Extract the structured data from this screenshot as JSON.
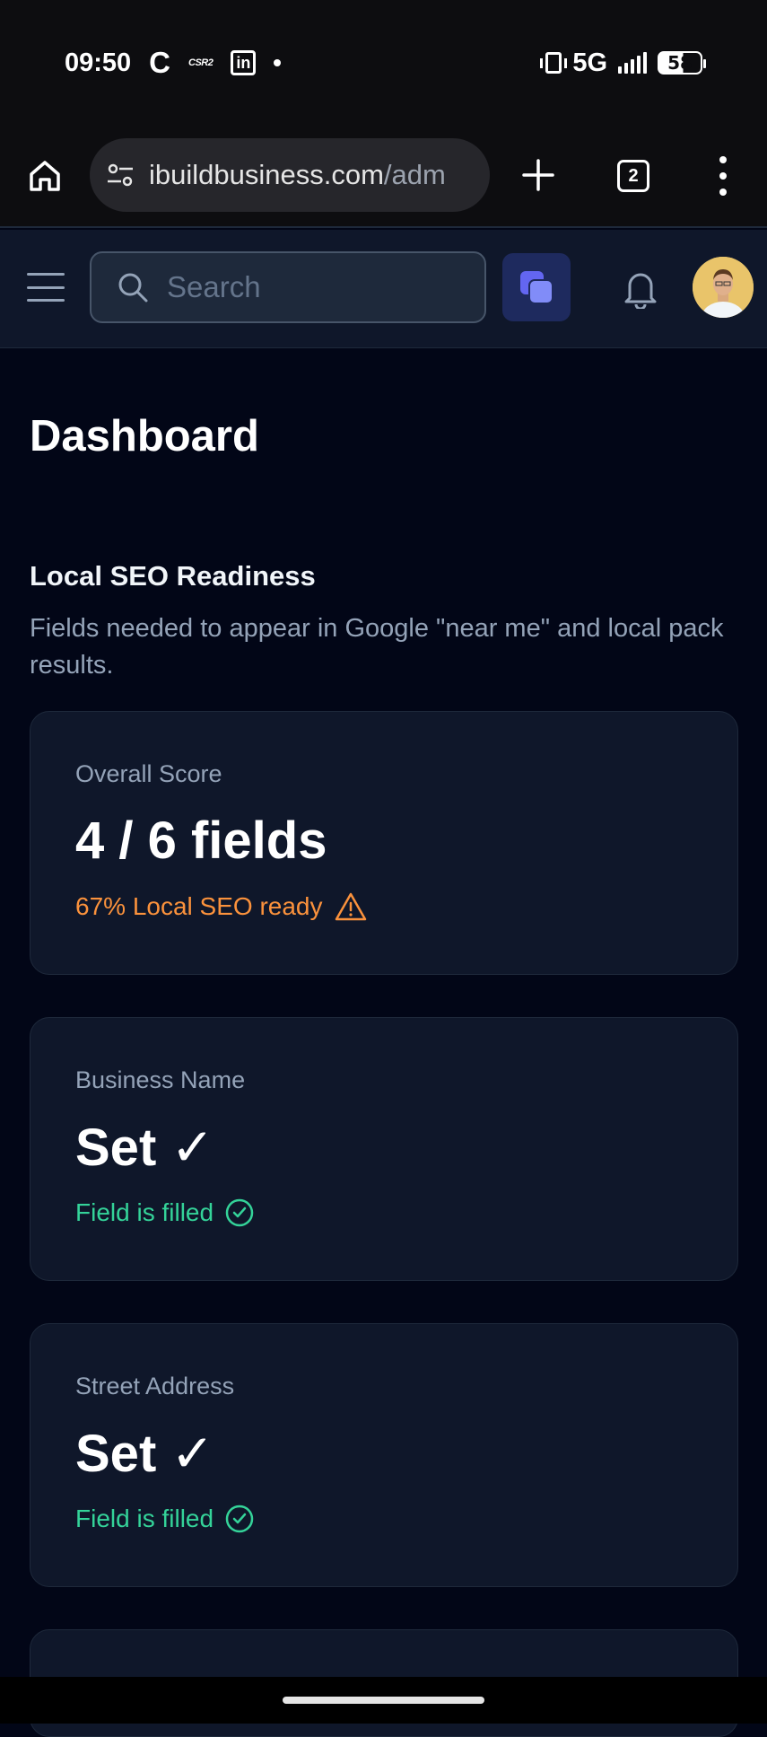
{
  "status_bar": {
    "time": "09:50",
    "app_icons": [
      "C",
      "CSR2"
    ],
    "network": "5G",
    "battery": "58"
  },
  "browser": {
    "url_main": "ibuildbusiness.com",
    "url_path": "/adm",
    "tab_count": "2"
  },
  "app_header": {
    "search_placeholder": "Search"
  },
  "page": {
    "title": "Dashboard",
    "section_title": "Local SEO Readiness",
    "section_description": "Fields needed to appear in Google \"near me\" and local pack results."
  },
  "cards": [
    {
      "label": "Overall Score",
      "value": "4 / 6 fields",
      "status": "67% Local SEO ready",
      "status_icon": "warning-triangle-icon",
      "status_color": "#fb923c"
    },
    {
      "label": "Business Name",
      "value": "Set ✓",
      "status": "Field is filled",
      "status_icon": "check-circle-icon",
      "status_color": "#34d399"
    },
    {
      "label": "Street Address",
      "value": "Set ✓",
      "status": "Field is filled",
      "status_icon": "check-circle-icon",
      "status_color": "#34d399"
    }
  ],
  "colors": {
    "background": "#020617",
    "card": "#0f172a",
    "accent": "#818cf8",
    "warning": "#fb923c",
    "success": "#34d399"
  }
}
